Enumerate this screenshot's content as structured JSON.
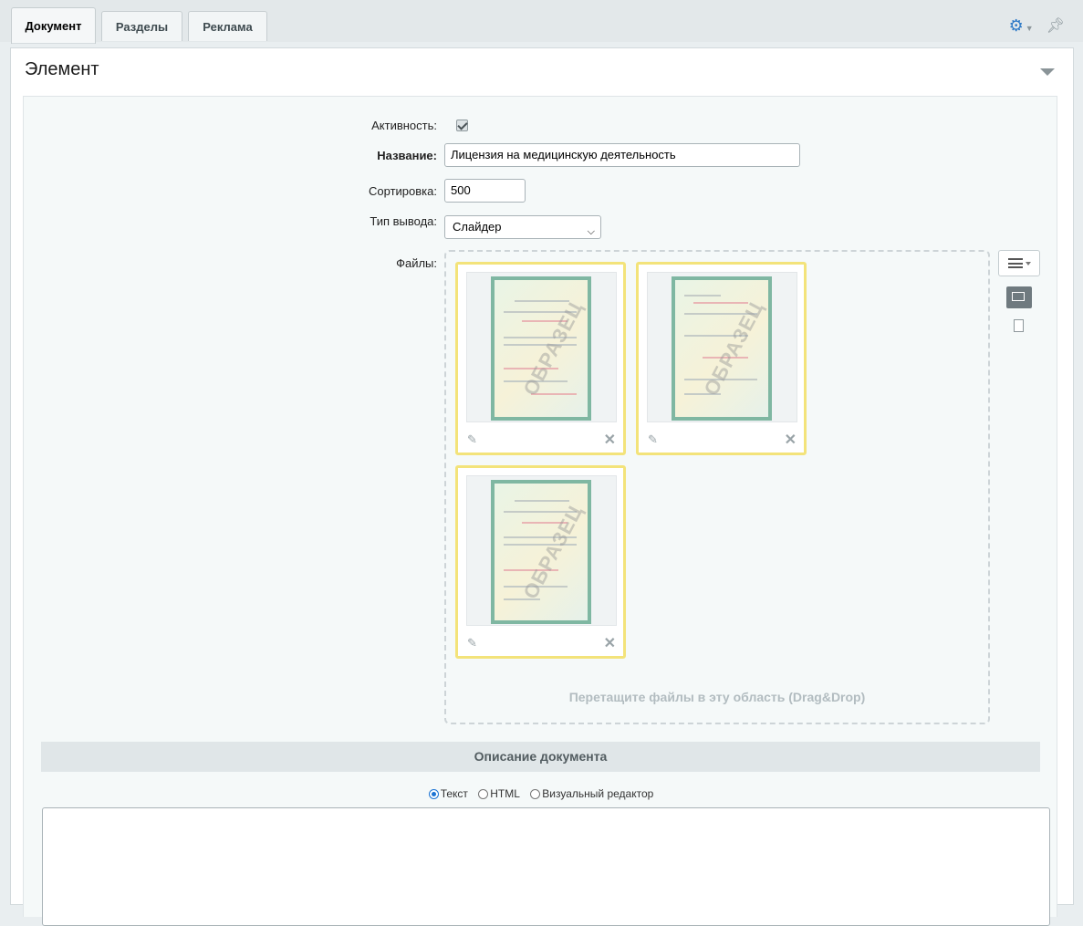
{
  "tabs": [
    {
      "label": "Документ",
      "active": true
    },
    {
      "label": "Разделы",
      "active": false
    },
    {
      "label": "Реклама",
      "active": false
    }
  ],
  "section": {
    "title": "Элемент"
  },
  "form": {
    "active_label": "Активность:",
    "active_checked": true,
    "name_label": "Название:",
    "name_value": "Лицензия на медицинскую деятельность",
    "sort_label": "Сортировка:",
    "sort_value": "500",
    "display_type_label": "Тип вывода:",
    "display_type_value": "Слайдер",
    "files_label": "Файлы:",
    "dropzone_text": "Перетащите файлы в эту область (Drag&Drop)",
    "files": [
      {
        "watermark": "ОБРАЗЕЦ"
      },
      {
        "watermark": "ОБРАЗЕЦ"
      },
      {
        "watermark": "ОБРАЗЕЦ"
      }
    ]
  },
  "description": {
    "header": "Описание документа",
    "modes": [
      {
        "label": "Текст",
        "selected": true
      },
      {
        "label": "HTML",
        "selected": false
      },
      {
        "label": "Визуальный редактор",
        "selected": false
      }
    ],
    "text": ""
  },
  "colors": {
    "accent": "#2d79c7",
    "thumb_border": "#f3e37a",
    "radio_selected": "#1b73d3"
  }
}
